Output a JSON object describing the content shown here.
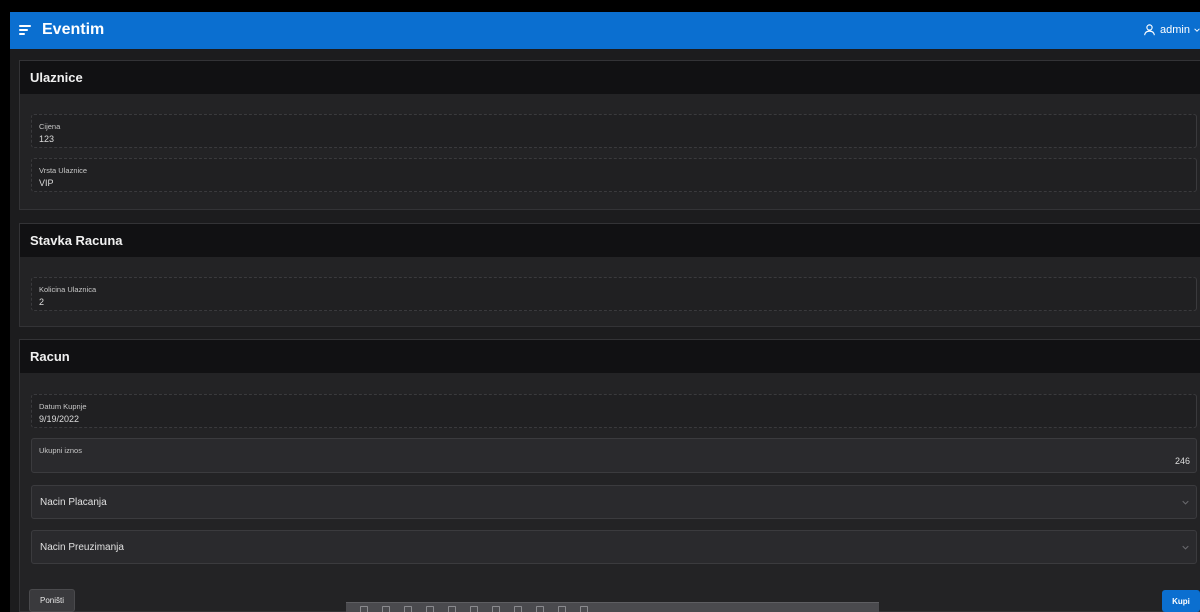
{
  "header": {
    "title": "Eventim",
    "user": "admin"
  },
  "regions": {
    "ulaznice": {
      "title": "Ulaznice",
      "cijena": {
        "label": "Cijena",
        "value": "123"
      },
      "vrsta": {
        "label": "Vrsta Ulaznice",
        "value": "VIP"
      }
    },
    "stavka": {
      "title": "Stavka Racuna",
      "kolicina": {
        "label": "Kolicina Ulaznica",
        "value": "2"
      }
    },
    "racun": {
      "title": "Racun",
      "datum": {
        "label": "Datum Kupnje",
        "value": "9/19/2022"
      },
      "iznos": {
        "label": "Ukupni iznos",
        "value": "246"
      },
      "nacin_placanja": {
        "label": "Nacin Placanja"
      },
      "nacin_preuzimanja": {
        "label": "Nacin Preuzimanja"
      }
    }
  },
  "buttons": {
    "reset": "Poništi",
    "buy": "Kupi"
  },
  "colors": {
    "header": "#0b6fd0",
    "primary_button": "#0b6fd0",
    "background": "#1c1c1e"
  }
}
